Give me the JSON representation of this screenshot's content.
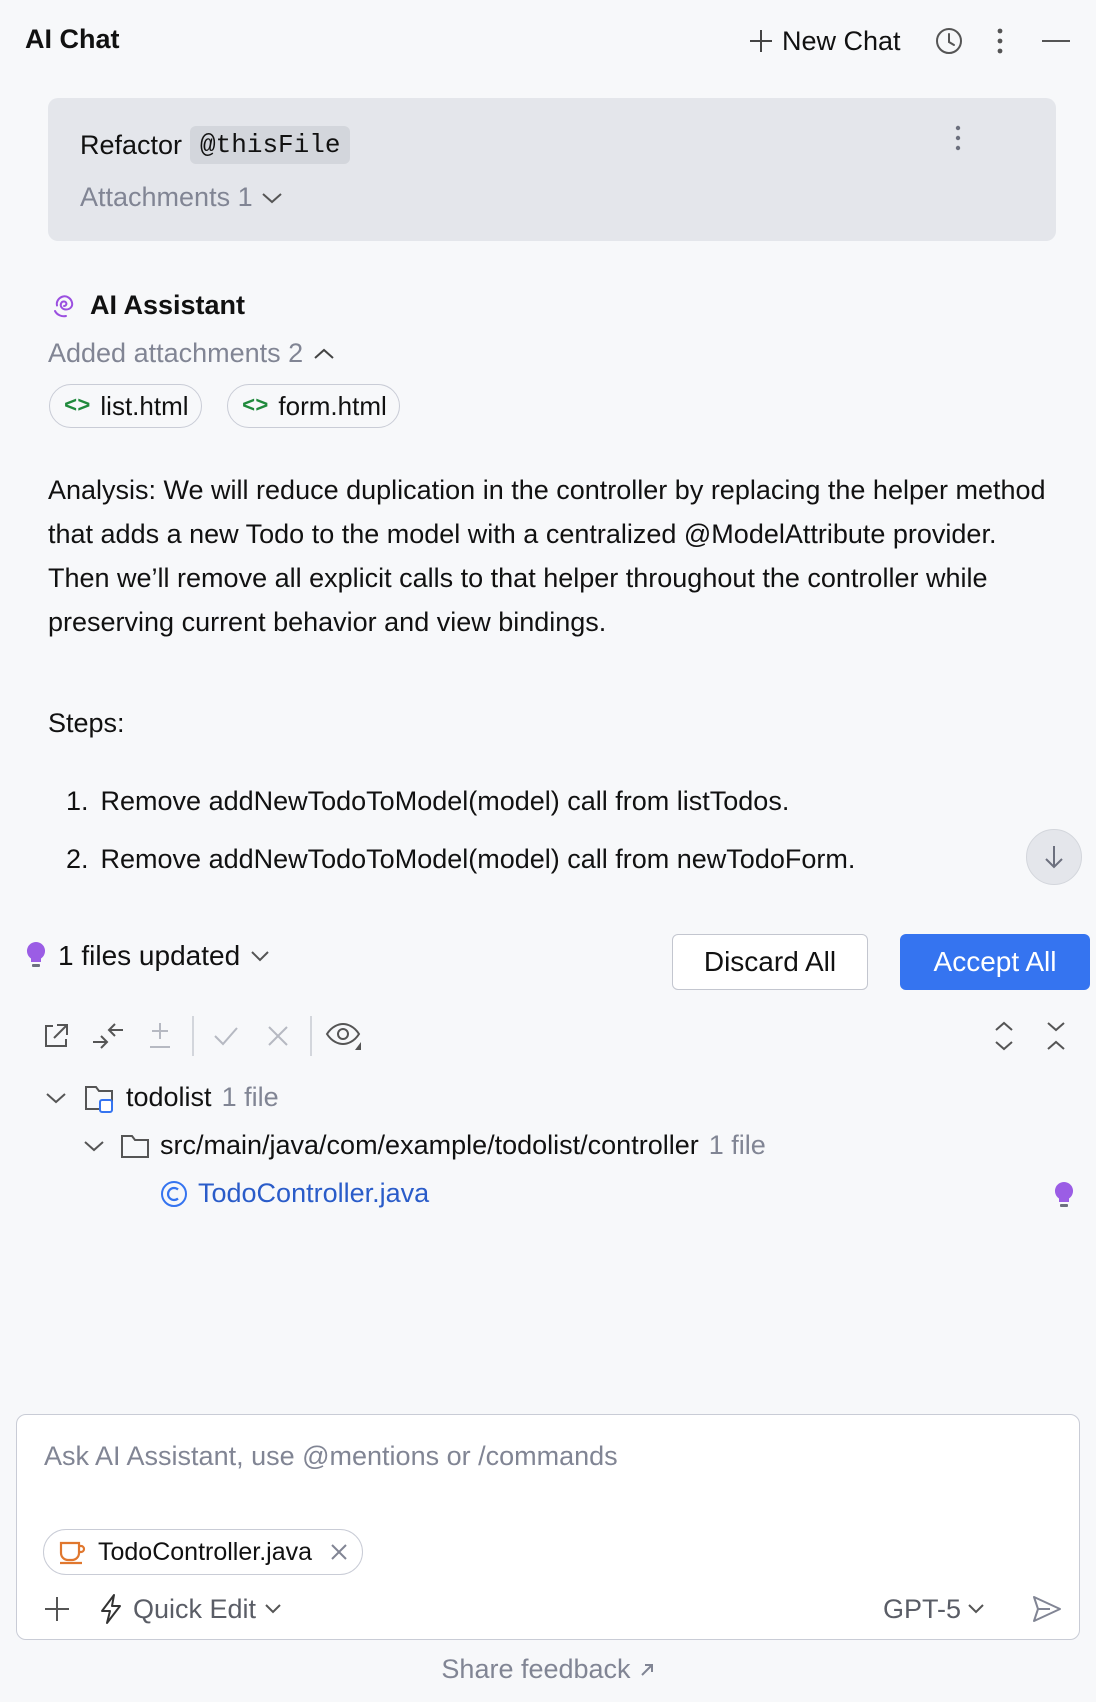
{
  "header": {
    "title": "AI Chat",
    "new_chat_label": "New Chat",
    "icons": [
      "plus-icon",
      "history-icon",
      "more-vertical-icon",
      "minimize-icon"
    ]
  },
  "user_message": {
    "text": "Refactor",
    "mention": "@thisFile",
    "attachments_label": "Attachments 1"
  },
  "assistant": {
    "name": "AI Assistant",
    "added_attachments_label": "Added attachments 2",
    "attachments": [
      "list.html",
      "form.html"
    ],
    "analysis": "Analysis: We will reduce duplication in the controller by replacing the helper method that adds a new Todo to the model with a centralized @ModelAttribute provider. Then we’ll remove all explicit calls to that helper throughout the controller while preserving current behavior and view bindings.",
    "steps_label": "Steps:",
    "steps": [
      {
        "num": "1.",
        "text": "Remove addNewTodoToModel(model) call from listTodos."
      },
      {
        "num": "2.",
        "text": "Remove addNewTodoToModel(model) call from newTodoForm."
      }
    ]
  },
  "changes": {
    "files_updated_label": "1 files updated",
    "discard_label": "Discard All",
    "accept_label": "Accept All",
    "accent_color": "#3574f0",
    "tree": {
      "project": {
        "name": "todolist",
        "count": "1 file"
      },
      "package": {
        "name": "src/main/java/com/example/todolist/controller",
        "count": "1 file"
      },
      "file": {
        "name": "TodoController.java"
      }
    }
  },
  "input": {
    "placeholder": "Ask AI Assistant, use @mentions or /commands",
    "context_file": "TodoController.java",
    "quick_edit_label": "Quick Edit",
    "model_label": "GPT-5"
  },
  "footer": {
    "feedback_label": "Share feedback"
  }
}
